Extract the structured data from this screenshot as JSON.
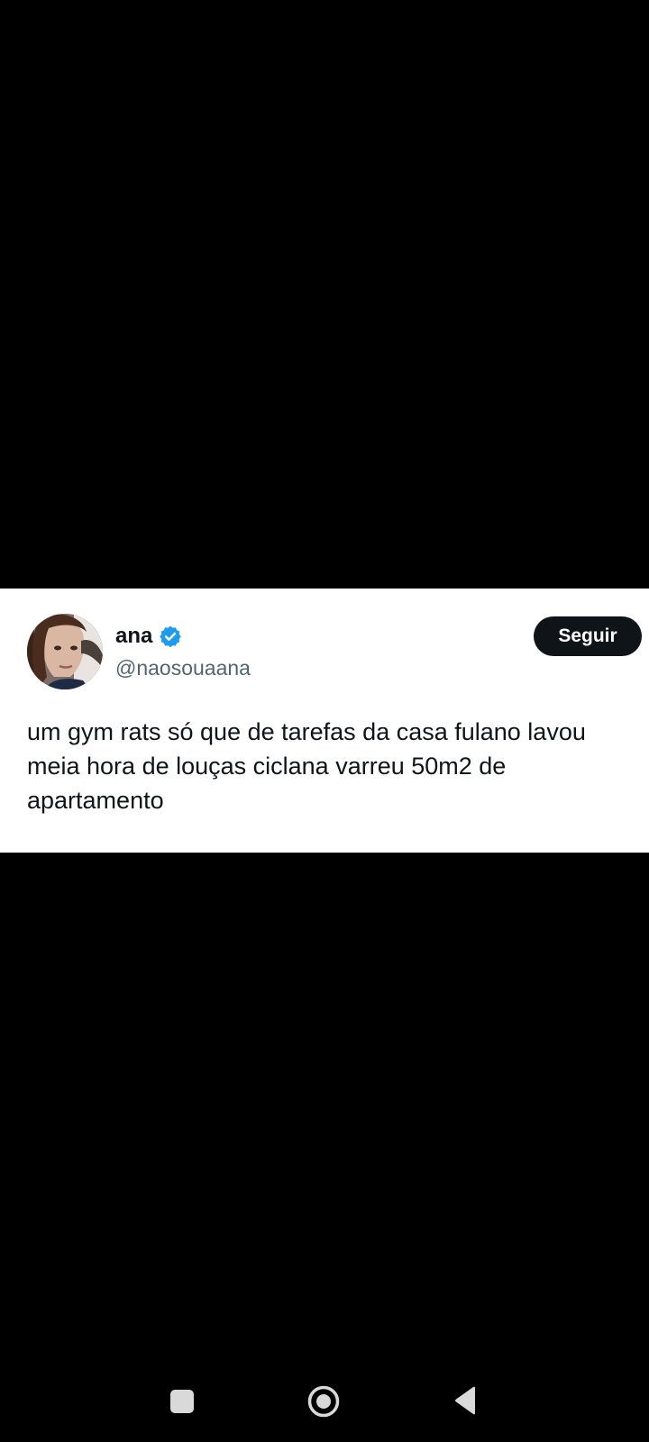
{
  "tweet": {
    "display_name": "ana",
    "handle": "@naosouaana",
    "verified": true,
    "follow_label": "Seguir",
    "text": "um gym rats só que de tarefas da casa fulano lavou meia hora de louças ciclana varreu 50m2 de apartamento"
  },
  "colors": {
    "background": "#000000",
    "card": "#ffffff",
    "text_primary": "#0f1419",
    "text_secondary": "#536471",
    "verified_blue": "#1d9bf0",
    "follow_button_bg": "#0f1419"
  },
  "nav_bar": {
    "icons": [
      "recents-icon",
      "home-icon",
      "back-icon"
    ]
  }
}
